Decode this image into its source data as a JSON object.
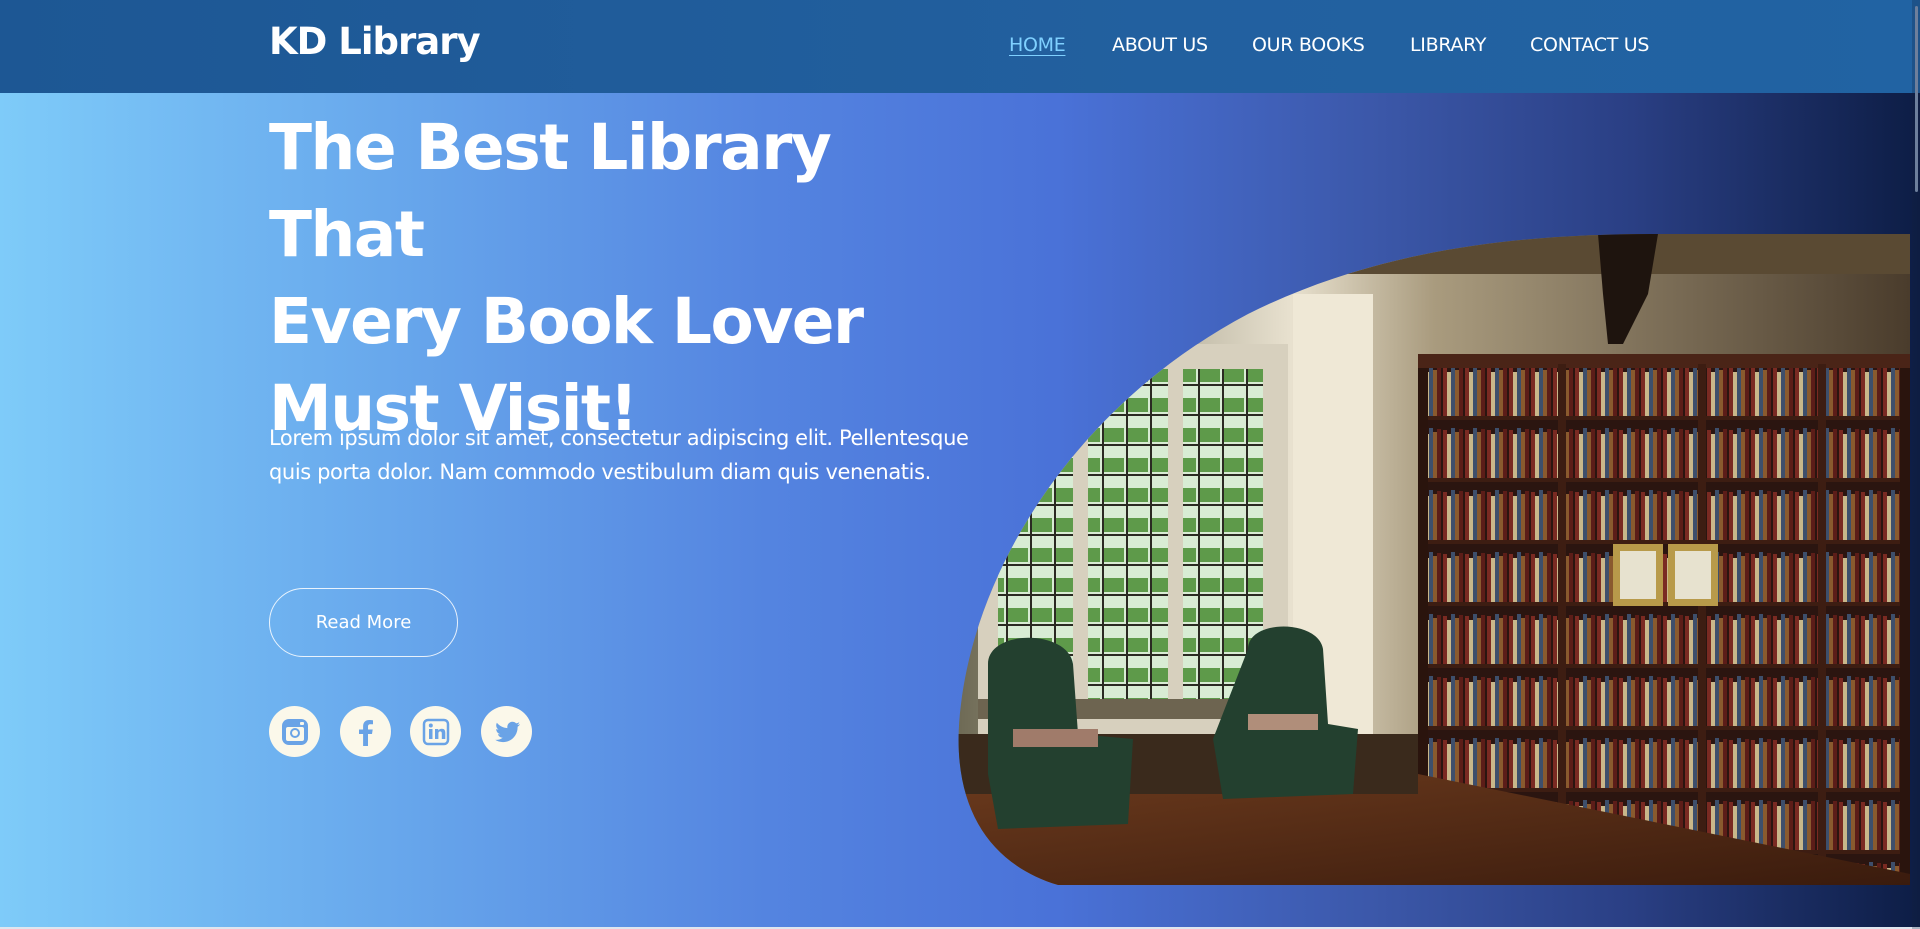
{
  "header": {
    "brand": "KD Library",
    "nav": [
      {
        "label": "HOME",
        "active": true
      },
      {
        "label": "ABOUT US",
        "active": false
      },
      {
        "label": "OUR BOOKS",
        "active": false
      },
      {
        "label": "LIBRARY",
        "active": false
      },
      {
        "label": "CONTACT US",
        "active": false
      }
    ]
  },
  "hero": {
    "headline_lines": [
      "The Best Library That",
      "Every Book Lover",
      "Must Visit!"
    ],
    "lead": "Lorem ipsum dolor sit amet, consectetur adipiscing elit. Pellentesque quis porta dolor. Nam commodo vestibulum diam quis venenatis.",
    "cta_label": "Read More",
    "social": [
      {
        "name": "instagram-icon"
      },
      {
        "name": "facebook-icon"
      },
      {
        "name": "linkedin-icon"
      },
      {
        "name": "twitter-icon"
      }
    ],
    "image_subject": "library-interior-photo"
  },
  "colors": {
    "header_bg": "#1d5794",
    "nav_active": "#7fd0ff",
    "gradient_start": "#7ecbf9",
    "gradient_mid": "#4a72d8",
    "gradient_end": "#0d1d45",
    "social_bg": "#fbf8ea",
    "social_fg": "#6aa3e6"
  }
}
